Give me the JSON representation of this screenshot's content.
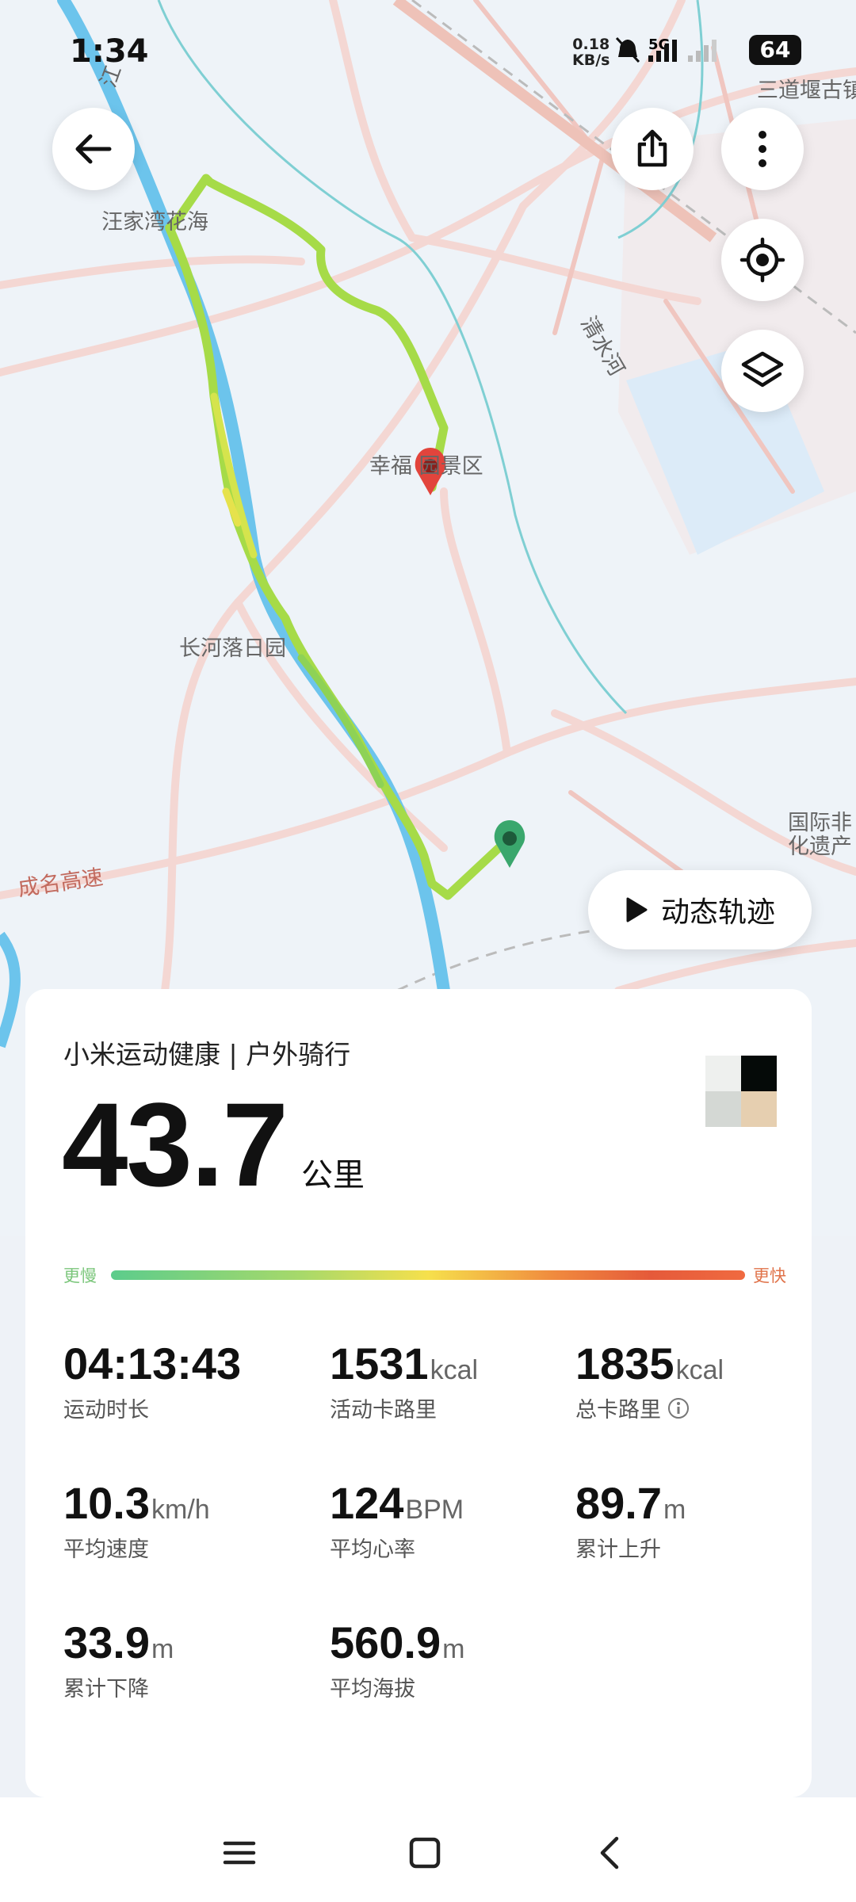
{
  "status_bar": {
    "time": "1:34",
    "net_speed_value": "0.18",
    "net_speed_unit": "KB/s",
    "network": "5G",
    "battery": "64"
  },
  "map": {
    "labels": {
      "wangjiawan": "汪家湾花海",
      "xingfu": "幸福 园景区",
      "changhe": "长河落日园",
      "chengming": "成名高速",
      "qingshuihe": "清水河",
      "sandaoyan": "三道堰古镇",
      "guoji": "国际非",
      "huayichan": "化遗产",
      "jiang": "江"
    },
    "route_colors": [
      "#9bdc46",
      "#c8e04a",
      "#7fcf5a"
    ],
    "start_marker_color": "#3aa76d",
    "end_marker_color": "#e2443c",
    "icons": {
      "back": "arrow-left-icon",
      "share": "share-icon",
      "more": "more-vertical-icon",
      "locate": "locate-icon",
      "layers": "layers-icon"
    }
  },
  "playback": {
    "label": "动态轨迹"
  },
  "summary": {
    "source": "小米运动健康 | 户外骑行",
    "distance_value": "43.7",
    "distance_unit": "公里",
    "speed_legend_slow": "更慢",
    "speed_legend_fast": "更快"
  },
  "stats": [
    {
      "value": "04:13:43",
      "unit": "",
      "label": "运动时长"
    },
    {
      "value": "1531",
      "unit": "kcal",
      "label": "活动卡路里"
    },
    {
      "value": "1835",
      "unit": "kcal",
      "label": "总卡路里"
    },
    {
      "value": "10.3",
      "unit": "km/h",
      "label": "平均速度"
    },
    {
      "value": "124",
      "unit": "BPM",
      "label": "平均心率"
    },
    {
      "value": "89.7",
      "unit": "m",
      "label": "累计上升"
    },
    {
      "value": "33.9",
      "unit": "m",
      "label": "累计下降"
    },
    {
      "value": "560.9",
      "unit": "m",
      "label": "平均海拔"
    }
  ]
}
